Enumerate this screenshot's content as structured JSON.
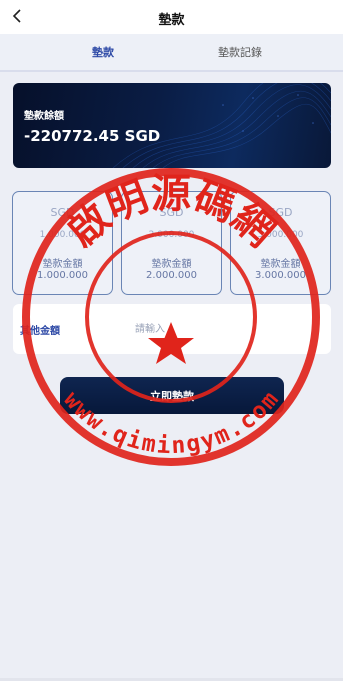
{
  "header": {
    "title": "墊款",
    "back_icon": "chevron-left-icon"
  },
  "tabs": [
    {
      "label": "墊款",
      "active": true
    },
    {
      "label": "墊款記錄",
      "active": false
    }
  ],
  "balance": {
    "label": "墊款餘額",
    "value": "-220772.45 SGD"
  },
  "options": [
    {
      "currency": "SGD",
      "amount": "1.000.000",
      "label": "墊款金額",
      "amount_label": "1.000.000"
    },
    {
      "currency": "SGD",
      "amount": "2.000.000",
      "label": "墊款金額",
      "amount_label": "2.000.000"
    },
    {
      "currency": "SGD",
      "amount": "3.000.000",
      "label": "墊款金額",
      "amount_label": "3.000.000"
    }
  ],
  "other": {
    "label": "其他金額",
    "placeholder": "請輸入"
  },
  "submit": {
    "label": "立即墊款"
  },
  "watermark": {
    "text": "啟明源碼網",
    "url": "www.qimingym.com"
  },
  "colors": {
    "accent": "#2d49a6",
    "card_dark": "#0a1d45",
    "stamp_red": "#e0241b",
    "background": "#eceef5"
  }
}
